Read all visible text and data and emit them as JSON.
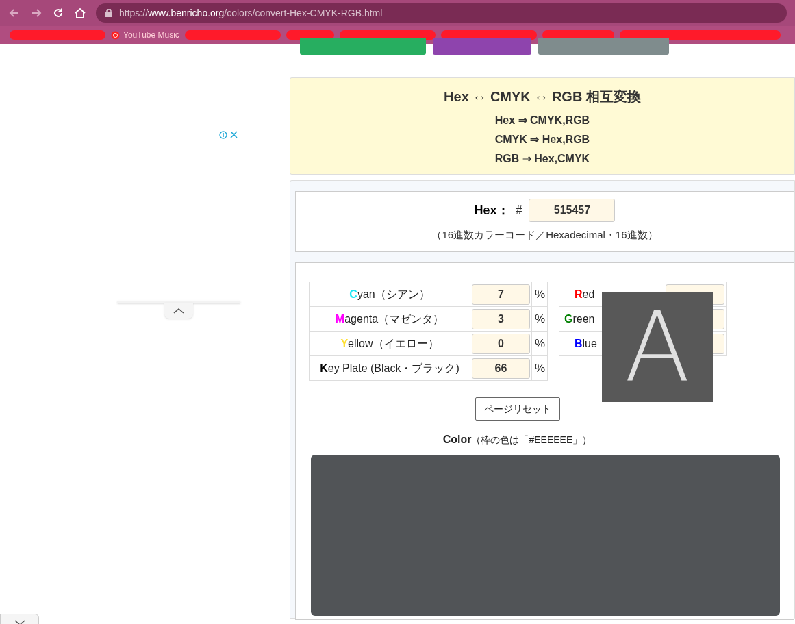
{
  "browser": {
    "url_scheme": "https://",
    "url_host": "www.benricho.org",
    "url_path": "/colors/convert-Hex-CMYK-RGB.html",
    "bookmarks": [
      {
        "kind": "redacted"
      },
      {
        "kind": "label",
        "label": "YouTube Music"
      },
      {
        "kind": "redacted"
      },
      {
        "kind": "redacted"
      },
      {
        "kind": "redacted"
      },
      {
        "kind": "redacted"
      },
      {
        "kind": "redacted"
      },
      {
        "kind": "redacted"
      }
    ]
  },
  "top_buttons": [
    {
      "color": "#27ae60"
    },
    {
      "color": "#8e44ad"
    },
    {
      "color": "#7f8c8d"
    }
  ],
  "header": {
    "title": "Hex ⇔ CMYK ⇔ RGB 相互変換",
    "lines": [
      "Hex ⇒ CMYK,RGB",
      "CMYK ⇒ Hex,RGB",
      "RGB ⇒ Hex,CMYK"
    ]
  },
  "hex": {
    "label": "Hex：",
    "hash": "#",
    "value": "515457",
    "note": "（16進数カラーコード／Hexadecimal・16進数）"
  },
  "cmyk": [
    {
      "label": "**C**yan（シアン）",
      "color": "#1ee8f5",
      "value": "7",
      "unit": "%"
    },
    {
      "label": "**M**agenta（マゼンタ）",
      "color": "#ff00ff",
      "value": "3",
      "unit": "%"
    },
    {
      "label": "**Y**ellow（イエロー）",
      "color": "#ffe033",
      "value": "0",
      "unit": "%"
    },
    {
      "label": "**K**ey Plate (Black・ブラック)",
      "color": "#000000",
      "value": "66",
      "unit": "%"
    }
  ],
  "rgb": [
    {
      "label": "**R**ed",
      "color": "#ff0000"
    },
    {
      "label": "**G**reen",
      "color": "#008000"
    },
    {
      "label": "**B**lue",
      "color": "#0000ff"
    }
  ],
  "reset_button": "ページリセット",
  "color_section": {
    "title": "Color",
    "note": "（枠の色は「#EEEEEE」）"
  },
  "overlay": {
    "letter": "A"
  }
}
